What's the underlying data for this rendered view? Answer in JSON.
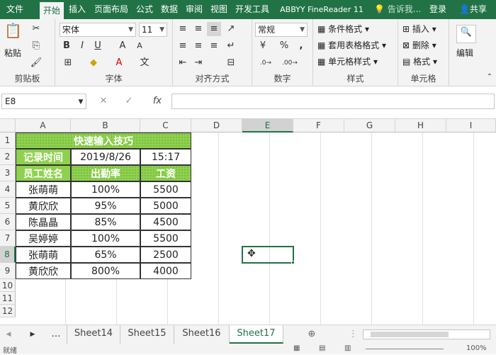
{
  "tabs": [
    "文件",
    "开始",
    "插入",
    "页面布局",
    "公式",
    "数据",
    "审阅",
    "视图",
    "开发工具",
    "ABBYY FineReader 11"
  ],
  "tell_me": "告诉我...",
  "login": "登录",
  "share": "共享",
  "ribbon": {
    "paste": "粘贴",
    "clipboard": "剪贴板",
    "font_name": "宋体",
    "font_size": "11",
    "font_group": "字体",
    "align_group": "对齐方式",
    "num_format": "常规",
    "num_group": "数字",
    "cond_format": "条件格式",
    "table_format": "套用表格格式",
    "cell_style": "单元格样式",
    "style_group": "样式",
    "insert": "插入",
    "delete": "删除",
    "format": "格式",
    "cells_group": "单元格",
    "edit": "编辑",
    "bold": "B",
    "italic": "I",
    "underline": "U",
    "percent": "%",
    "comma": ","
  },
  "namebox": "E8",
  "fx": "fx",
  "columns": [
    "A",
    "B",
    "C",
    "D",
    "E",
    "F",
    "G",
    "H",
    "I"
  ],
  "rows": [
    "1",
    "2",
    "3",
    "4",
    "5",
    "6",
    "7",
    "8",
    "9",
    "10",
    "11",
    "12"
  ],
  "table": {
    "title": "快速输入技巧",
    "r2": [
      "记录时间",
      "2019/8/26",
      "15:17"
    ],
    "headers": [
      "员工姓名",
      "出勤率",
      "工资"
    ],
    "data": [
      [
        "张萌萌",
        "100%",
        "5500"
      ],
      [
        "黄欣欣",
        "95%",
        "5000"
      ],
      [
        "陈晶晶",
        "85%",
        "4500"
      ],
      [
        "吴婷婷",
        "100%",
        "5500"
      ],
      [
        "张萌萌",
        "65%",
        "2500"
      ],
      [
        "黄欣欣",
        "800%",
        "4000"
      ]
    ]
  },
  "sheets": [
    "Sheet14",
    "Sheet15",
    "Sheet16",
    "Sheet17"
  ],
  "active_sheet": "Sheet17",
  "status": "就绪",
  "zoom": "100%",
  "accent": "#217346",
  "green": "#8fd14f"
}
